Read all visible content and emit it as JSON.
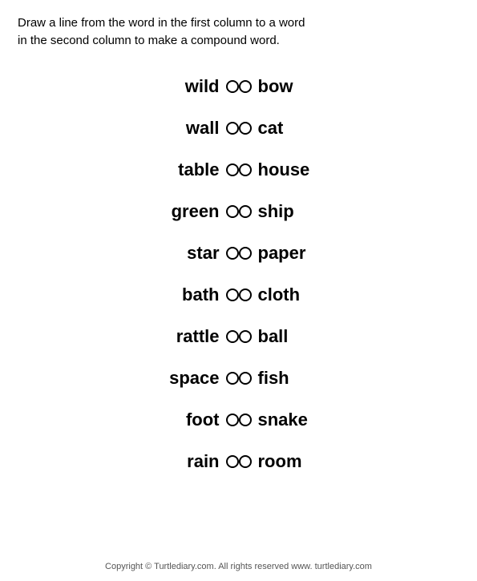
{
  "instructions": {
    "line1": "Draw a line from the word in the first column to a word",
    "line2": "in the second column to make a compound word."
  },
  "left_words": [
    "wild",
    "wall",
    "table",
    "green",
    "star",
    "bath",
    "rattle",
    "space",
    "foot",
    "rain"
  ],
  "right_words": [
    "bow",
    "cat",
    "house",
    "ship",
    "paper",
    "cloth",
    "ball",
    "fish",
    "snake",
    "room"
  ],
  "footer": {
    "text": "Copyright © Turtlediary.com. All rights reserved   www. turtlediary.com"
  }
}
